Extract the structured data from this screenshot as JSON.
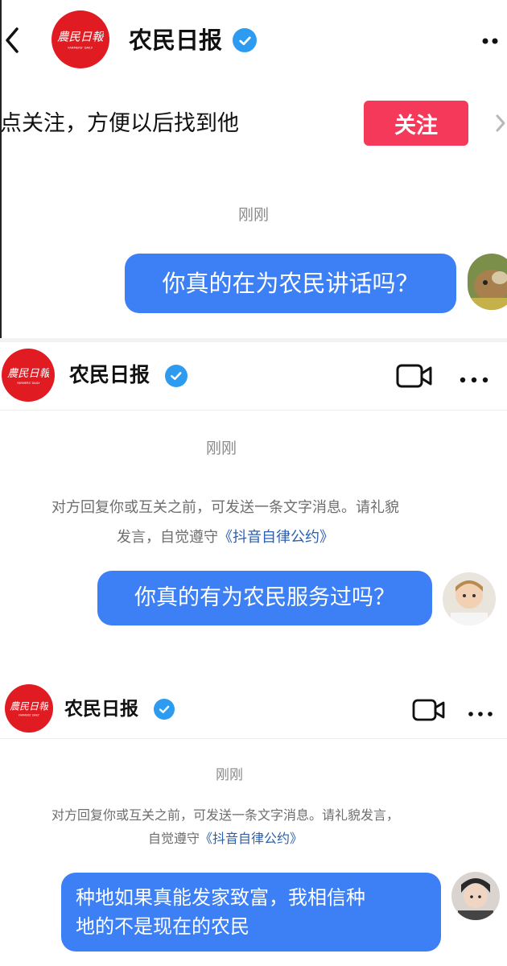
{
  "panel1": {
    "account_name": "农民日报",
    "follow_prompt": "点关注，方便以后找到他",
    "follow_button": "关注",
    "timestamp": "刚刚",
    "message": "你真的在为农民讲话吗？"
  },
  "panel2": {
    "account_name": "农民日报",
    "timestamp": "刚刚",
    "notice_line1": "对方回复你或互关之前，可发送一条文字消息。请礼貌",
    "notice_line2_prefix": "发言，自觉遵守",
    "notice_link": "《抖音自律公约》",
    "message": "你真的有为农民服务过吗？"
  },
  "panel3": {
    "account_name": "农民日报",
    "timestamp": "刚刚",
    "notice_line1": "对方回复你或互关之前，可发送一条文字消息。请礼貌发言，",
    "notice_line2_prefix": "自觉遵守",
    "notice_link": "《抖音自律公约》",
    "message_line1": "种地如果真能发家致富，我相信种",
    "message_line2": "地的不是现在的农民"
  },
  "colors": {
    "bubble": "#3d7ff5",
    "follow_button": "#f4395a",
    "verified": "#2d9cf0",
    "logo": "#e11b22",
    "link": "#2a5fb0"
  },
  "icons": {
    "back": "back-arrow-icon",
    "more": "more-dots-icon",
    "video": "video-call-icon",
    "verified": "verified-badge-icon",
    "chevron": "chevron-right-icon"
  }
}
